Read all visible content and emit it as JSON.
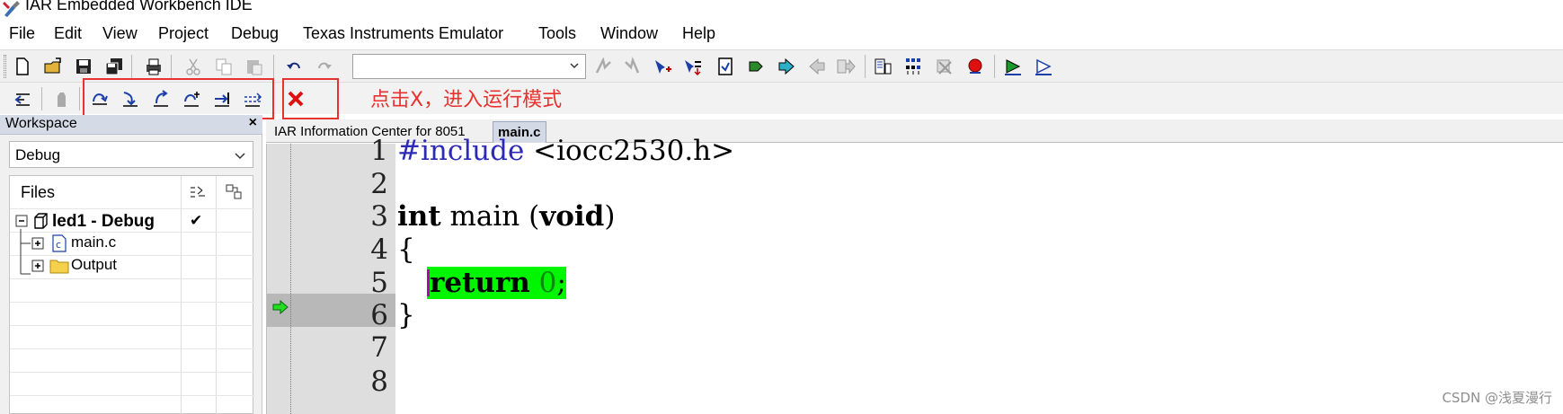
{
  "titlebar": {
    "title": "IAR Embedded Workbench IDE"
  },
  "menu": [
    "File",
    "Edit",
    "View",
    "Project",
    "Debug",
    "Texas Instruments Emulator",
    "Tools",
    "Window",
    "Help"
  ],
  "annotation": "点击X，进入运行模式",
  "workspace": {
    "title": "Workspace",
    "close": "×",
    "config": "Debug",
    "files_header": "Files",
    "project": "led1 - Debug",
    "check": "✔",
    "items": [
      "main.c",
      "Output"
    ]
  },
  "tabs": [
    "IAR Information Center for 8051",
    "main.c"
  ],
  "editor": {
    "line_numbers": [
      "1",
      "2",
      "3",
      "4",
      "5",
      "6",
      "7",
      "8"
    ],
    "line1_kw": "#include",
    "line1_rest": " <iocc2530.h>",
    "line3_int": "int",
    "line3_mid": " main (",
    "line3_void": "void",
    "line3_end": ")",
    "line4": "{",
    "line5_kw": "return",
    "line5_num": " 0",
    "line5_end": ";",
    "line6": "}"
  },
  "watermark": "CSDN @浅夏漫行",
  "colors": {
    "annotation_red": "#e8322f",
    "highlight_green": "#00f500",
    "keyword_blue": "#2d2ab5",
    "cursor_magenta": "#b000b0"
  }
}
